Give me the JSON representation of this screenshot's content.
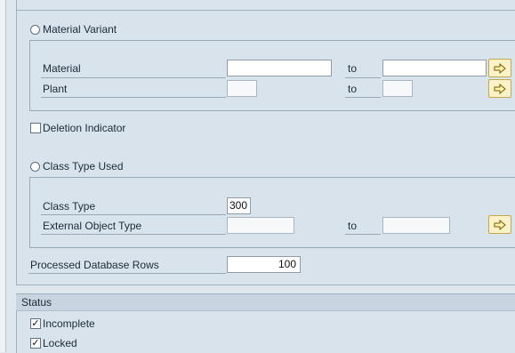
{
  "material_variant": {
    "radio_label": "Material Variant",
    "material": {
      "label": "Material",
      "value_from": "",
      "to_label": "to",
      "value_to": ""
    },
    "plant": {
      "label": "Plant",
      "value_from": "",
      "to_label": "to",
      "value_to": ""
    }
  },
  "deletion_indicator": {
    "label": "Deletion Indicator",
    "checked": false
  },
  "class_type_used": {
    "radio_label": "Class Type Used",
    "class_type": {
      "label": "Class Type",
      "value": "300"
    },
    "external_object_type": {
      "label": "External Object Type",
      "value_from": "",
      "to_label": "to",
      "value_to": ""
    }
  },
  "processed_rows": {
    "label": "Processed Database Rows",
    "value": "100"
  },
  "status": {
    "title": "Status",
    "incomplete": {
      "label": "Incomplete",
      "checked": true
    },
    "locked": {
      "label": "Locked",
      "checked": true
    }
  },
  "icons": {
    "multiple_selection": "multiple-selection-arrow-icon",
    "check": "checkmark-icon"
  },
  "colors": {
    "background": "#d9e3ec",
    "frame_border": "#98a9b8",
    "select_button": "#fbf2c8",
    "select_arrow": "#8a6a00"
  }
}
